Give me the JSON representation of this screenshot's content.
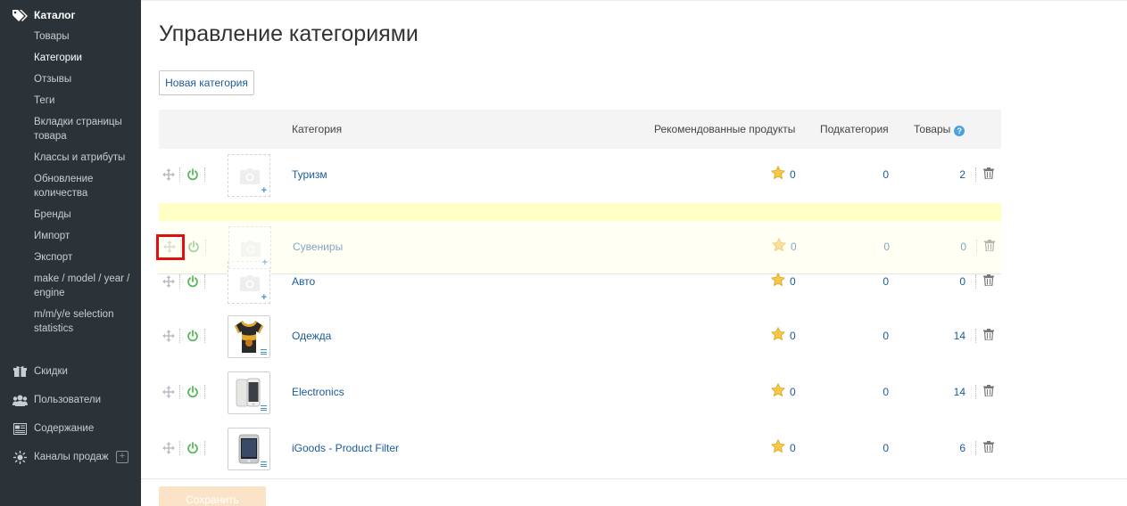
{
  "sidebar": {
    "catalog": {
      "title": "Каталог",
      "items": [
        {
          "label": "Товары",
          "active": false
        },
        {
          "label": "Категории",
          "active": true
        },
        {
          "label": "Отзывы",
          "active": false
        },
        {
          "label": "Теги",
          "active": false
        },
        {
          "label": "Вкладки страницы товара",
          "active": false
        },
        {
          "label": "Классы и атрибуты",
          "active": false
        },
        {
          "label": "Обновление количества",
          "active": false
        },
        {
          "label": "Бренды",
          "active": false
        },
        {
          "label": "Импорт",
          "active": false
        },
        {
          "label": "Экспорт",
          "active": false
        },
        {
          "label": "make / model / year / engine",
          "active": false
        },
        {
          "label": "m/m/y/e selection statistics",
          "active": false
        }
      ]
    },
    "sections": [
      {
        "label": "Скидки",
        "icon": "gift-icon"
      },
      {
        "label": "Пользователи",
        "icon": "users-icon"
      },
      {
        "label": "Содержание",
        "icon": "content-icon"
      },
      {
        "label": "Каналы продаж",
        "icon": "sun-icon",
        "plus": "+"
      }
    ]
  },
  "page": {
    "title": "Управление категориями",
    "new_category_button": "Новая категория",
    "save_button": "Сохранить"
  },
  "table": {
    "headers": {
      "category": "Категория",
      "featured": "Рекомендованные продукты",
      "subcategory": "Подкатегория",
      "products": "Товары",
      "help": "?"
    },
    "rows": [
      {
        "name": "Туризм",
        "featured": "0",
        "subcategories": "0",
        "products": "2",
        "image": "placeholder"
      },
      {
        "name": "Сувениры",
        "featured": "0",
        "subcategories": "0",
        "products": "0",
        "image": "placeholder",
        "state": "dragging"
      },
      {
        "name": "Авто",
        "featured": "0",
        "subcategories": "0",
        "products": "0",
        "image": "placeholder"
      },
      {
        "name": "Одежда",
        "featured": "0",
        "subcategories": "0",
        "products": "14",
        "image": "jersey"
      },
      {
        "name": "Electronics",
        "featured": "0",
        "subcategories": "0",
        "products": "14",
        "image": "phone"
      },
      {
        "name": "iGoods - Product Filter",
        "featured": "0",
        "subcategories": "0",
        "products": "6",
        "image": "phone"
      }
    ]
  },
  "colors": {
    "sidebar_bg": "#2b3338",
    "link": "#1a5b9c",
    "power_green": "#5cb85c",
    "placeholder_yellow": "#ffffc6",
    "highlight_red": "#e01010",
    "save_button_bg": "#fbe3c8"
  }
}
